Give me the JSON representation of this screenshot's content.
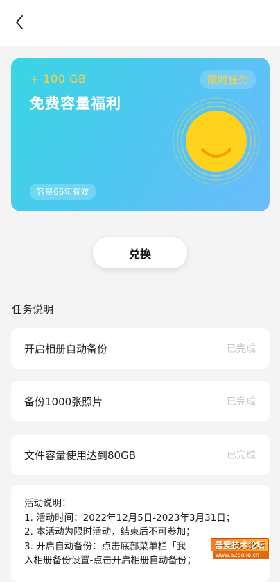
{
  "header": {
    "back_icon": "chevron-left-icon"
  },
  "card": {
    "capacity": "+ 100 GB",
    "title": "免费容量福利",
    "tag": "限时任务",
    "validity": "容量66年有效",
    "smiley_icon": "smiley-face-icon",
    "colors": {
      "gradient_start": "#39d6e3",
      "gradient_end": "#6cbcfb",
      "accent": "#ffd23c",
      "smiley": "#ffd21e"
    }
  },
  "exchange_button": {
    "label": "兑换"
  },
  "tasks": {
    "section_title": "任务说明",
    "items": [
      {
        "label": "开启相册自动备份",
        "status": "已完成"
      },
      {
        "label": "备份1000张照片",
        "status": "已完成"
      },
      {
        "label": "文件容量使用达到80GB",
        "status": "已完成"
      }
    ]
  },
  "notes": {
    "lines": [
      "活动说明：",
      "1. 活动时间：2022年12月5日-2023年3月31日；",
      "2. 本活动为限时活动，结束后不可参加；",
      "3. 开启自动备份：点击底部菜单栏「我",
      "入相册备份设置-点击开启相册自动备份；"
    ]
  },
  "watermark": {
    "main": "吾爱技术论坛",
    "sub": "www.52pojie.cn"
  }
}
